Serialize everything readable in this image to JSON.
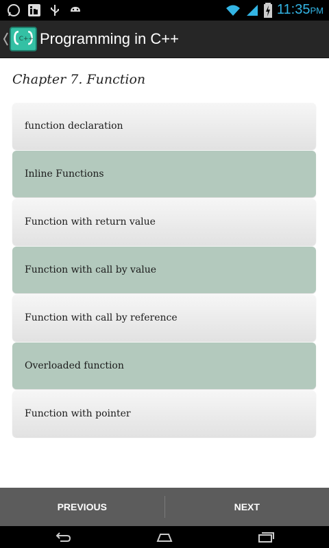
{
  "status_bar": {
    "time": "11:35",
    "ampm": "PM",
    "left_icons": [
      "whatsapp-icon",
      "linkedin-icon",
      "usb-icon",
      "android-icon"
    ],
    "right_icons": [
      "wifi-icon",
      "signal-icon",
      "battery-charging-icon"
    ],
    "clock_color": "#33b5e5"
  },
  "action_bar": {
    "title": "Programming in C++",
    "logo_icon": "cpp-logo-icon",
    "up_icon": "back-caret-icon"
  },
  "chapter": {
    "title": "Chapter 7. Function"
  },
  "topics": [
    {
      "label": "function declaration"
    },
    {
      "label": "Inline Functions"
    },
    {
      "label": "Function with return value"
    },
    {
      "label": "Function with call by value"
    },
    {
      "label": "Function with call by reference"
    },
    {
      "label": "Overloaded function"
    },
    {
      "label": "Function with pointer"
    }
  ],
  "nav": {
    "previous_label": "PREVIOUS",
    "next_label": "NEXT"
  },
  "system_nav": [
    "back-icon",
    "home-icon",
    "recent-apps-icon"
  ],
  "colors": {
    "action_bar": "#262626",
    "accent_item": "#b3c9bd",
    "logo": "#34c0a4",
    "nav_bar": "#5c5c5c"
  }
}
